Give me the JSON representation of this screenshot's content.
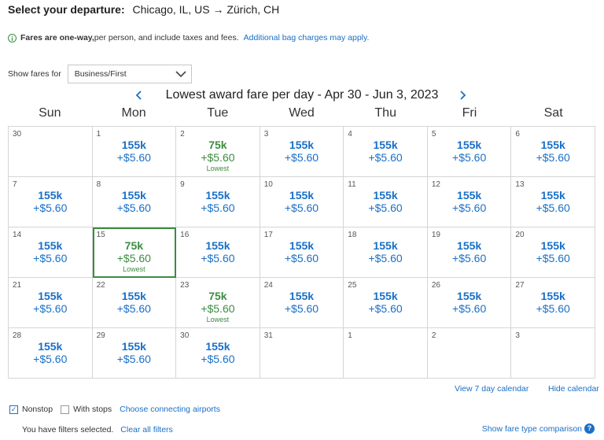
{
  "header": {
    "label": "Select your departure:",
    "route": "Chicago, IL, US → Zürich, CH"
  },
  "notice": {
    "icon": "info-circle-icon",
    "bold": "Fares are one-way,",
    "text": " per person, and include taxes and fees.",
    "link": "Additional bag charges may apply."
  },
  "fare_filter": {
    "label": "Show fares for",
    "value": "Business/First"
  },
  "calendar": {
    "title": "Lowest award fare per day - Apr 30 - Jun 3, 2023",
    "weekdays": [
      "Sun",
      "Mon",
      "Tue",
      "Wed",
      "Thu",
      "Fri",
      "Sat"
    ],
    "selected_day": "15",
    "cells": [
      {
        "day": "30",
        "miles": "",
        "tax": "",
        "lowest": ""
      },
      {
        "day": "1",
        "miles": "155k",
        "tax": "+$5.60",
        "lowest": ""
      },
      {
        "day": "2",
        "miles": "75k",
        "tax": "+$5.60",
        "lowest": "Lowest"
      },
      {
        "day": "3",
        "miles": "155k",
        "tax": "+$5.60",
        "lowest": ""
      },
      {
        "day": "4",
        "miles": "155k",
        "tax": "+$5.60",
        "lowest": ""
      },
      {
        "day": "5",
        "miles": "155k",
        "tax": "+$5.60",
        "lowest": ""
      },
      {
        "day": "6",
        "miles": "155k",
        "tax": "+$5.60",
        "lowest": ""
      },
      {
        "day": "7",
        "miles": "155k",
        "tax": "+$5.60",
        "lowest": ""
      },
      {
        "day": "8",
        "miles": "155k",
        "tax": "+$5.60",
        "lowest": ""
      },
      {
        "day": "9",
        "miles": "155k",
        "tax": "+$5.60",
        "lowest": ""
      },
      {
        "day": "10",
        "miles": "155k",
        "tax": "+$5.60",
        "lowest": ""
      },
      {
        "day": "11",
        "miles": "155k",
        "tax": "+$5.60",
        "lowest": ""
      },
      {
        "day": "12",
        "miles": "155k",
        "tax": "+$5.60",
        "lowest": ""
      },
      {
        "day": "13",
        "miles": "155k",
        "tax": "+$5.60",
        "lowest": ""
      },
      {
        "day": "14",
        "miles": "155k",
        "tax": "+$5.60",
        "lowest": ""
      },
      {
        "day": "15",
        "miles": "75k",
        "tax": "+$5.60",
        "lowest": "Lowest"
      },
      {
        "day": "16",
        "miles": "155k",
        "tax": "+$5.60",
        "lowest": ""
      },
      {
        "day": "17",
        "miles": "155k",
        "tax": "+$5.60",
        "lowest": ""
      },
      {
        "day": "18",
        "miles": "155k",
        "tax": "+$5.60",
        "lowest": ""
      },
      {
        "day": "19",
        "miles": "155k",
        "tax": "+$5.60",
        "lowest": ""
      },
      {
        "day": "20",
        "miles": "155k",
        "tax": "+$5.60",
        "lowest": ""
      },
      {
        "day": "21",
        "miles": "155k",
        "tax": "+$5.60",
        "lowest": ""
      },
      {
        "day": "22",
        "miles": "155k",
        "tax": "+$5.60",
        "lowest": ""
      },
      {
        "day": "23",
        "miles": "75k",
        "tax": "+$5.60",
        "lowest": "Lowest"
      },
      {
        "day": "24",
        "miles": "155k",
        "tax": "+$5.60",
        "lowest": ""
      },
      {
        "day": "25",
        "miles": "155k",
        "tax": "+$5.60",
        "lowest": ""
      },
      {
        "day": "26",
        "miles": "155k",
        "tax": "+$5.60",
        "lowest": ""
      },
      {
        "day": "27",
        "miles": "155k",
        "tax": "+$5.60",
        "lowest": ""
      },
      {
        "day": "28",
        "miles": "155k",
        "tax": "+$5.60",
        "lowest": ""
      },
      {
        "day": "29",
        "miles": "155k",
        "tax": "+$5.60",
        "lowest": ""
      },
      {
        "day": "30",
        "miles": "155k",
        "tax": "+$5.60",
        "lowest": ""
      },
      {
        "day": "31",
        "miles": "",
        "tax": "",
        "lowest": ""
      },
      {
        "day": "1",
        "miles": "",
        "tax": "",
        "lowest": ""
      },
      {
        "day": "2",
        "miles": "",
        "tax": "",
        "lowest": ""
      },
      {
        "day": "3",
        "miles": "",
        "tax": "",
        "lowest": ""
      }
    ]
  },
  "links": {
    "seven_day": "View 7 day calendar",
    "hide": "Hide calendar"
  },
  "filters": {
    "nonstop": {
      "label": "Nonstop",
      "checked": true
    },
    "with_stops": {
      "label": "With stops",
      "checked": false
    },
    "connecting": "Choose connecting airports",
    "status": "You have filters selected.",
    "clear": "Clear all filters"
  },
  "compare": {
    "label": "Show fare type comparison",
    "icon": "help-circle-icon"
  },
  "colors": {
    "link": "#1a6fc7",
    "lowest": "#3d8c40",
    "border": "#d5d5d5"
  }
}
